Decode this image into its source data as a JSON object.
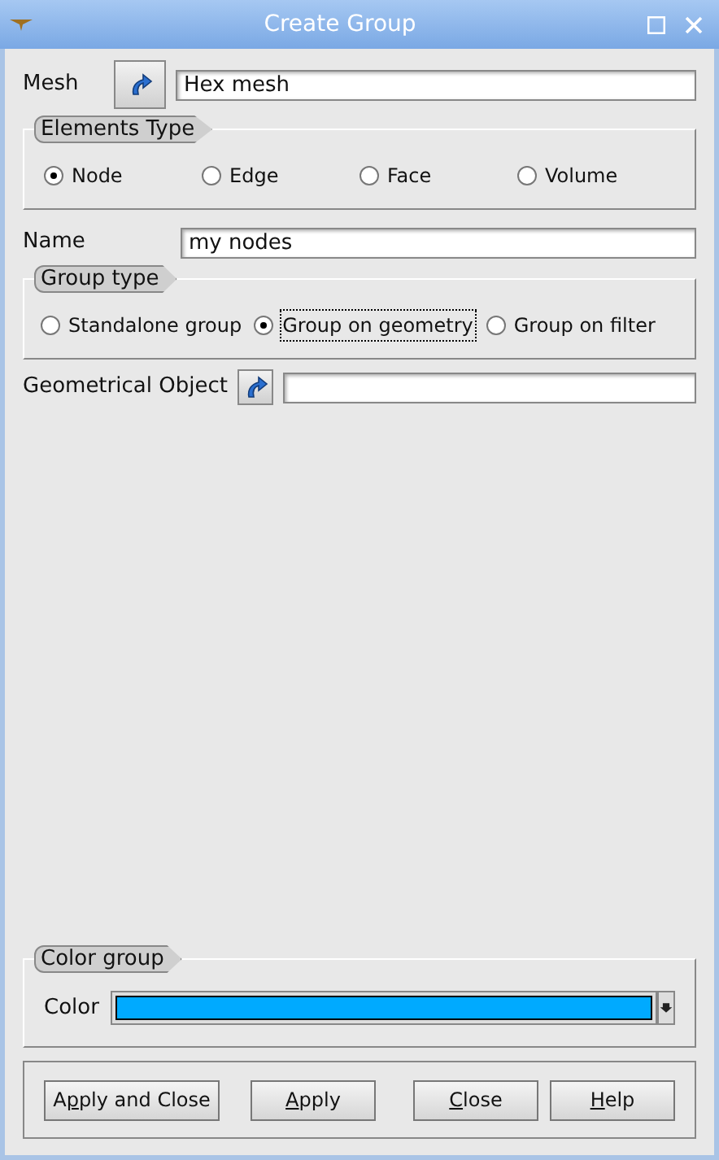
{
  "window": {
    "title": "Create Group"
  },
  "mesh": {
    "label": "Mesh",
    "value": "Hex mesh"
  },
  "elements_type": {
    "title": "Elements Type",
    "options": [
      {
        "label": "Node",
        "selected": true
      },
      {
        "label": "Edge",
        "selected": false
      },
      {
        "label": "Face",
        "selected": false
      },
      {
        "label": "Volume",
        "selected": false
      }
    ]
  },
  "name": {
    "label": "Name",
    "value": "my nodes"
  },
  "group_type": {
    "title": "Group type",
    "options": [
      {
        "label": "Standalone group",
        "selected": false
      },
      {
        "label": "Group on geometry",
        "selected": true
      },
      {
        "label": "Group on filter",
        "selected": false
      }
    ]
  },
  "geometrical_object": {
    "label": "Geometrical Object"
  },
  "color_group": {
    "title": "Color group",
    "label": "Color",
    "color": "#00aaff"
  },
  "buttons": [
    {
      "before": "A",
      "key": "p",
      "after": "ply and Close"
    },
    {
      "key": "A",
      "after": "pply"
    },
    {
      "key": "C",
      "after": "lose"
    },
    {
      "key": "H",
      "after": "elp"
    }
  ]
}
